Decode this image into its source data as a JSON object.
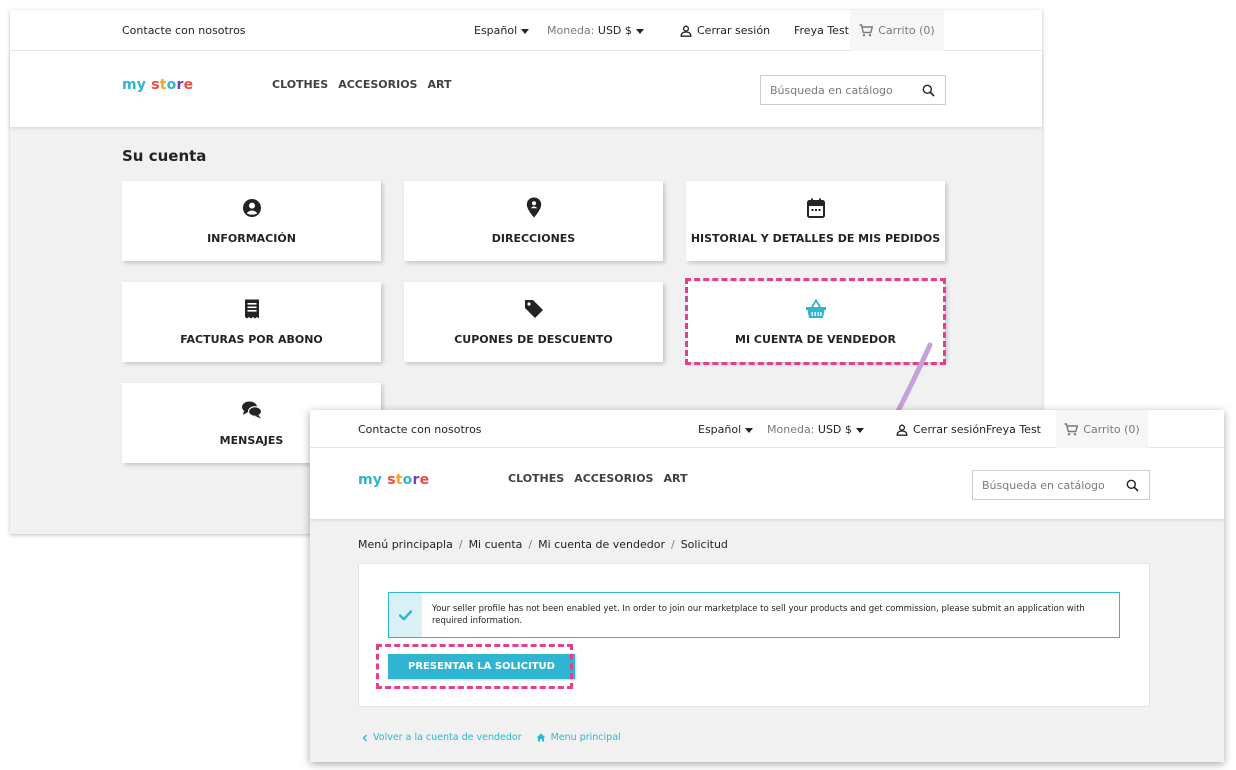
{
  "colors": {
    "accent": "#2fb5d2",
    "highlight_dash": "#e2408e",
    "arrow": "#c6a0d8"
  },
  "back": {
    "topbar": {
      "contact": "Contacte con nosotros",
      "language": "Español",
      "currency_label": "Moneda:",
      "currency_value": "USD $",
      "logout": "Cerrar sesión",
      "user": "Freya Test",
      "cart": "Carrito (0)"
    },
    "header": {
      "logo": [
        "my",
        " ",
        "s",
        "t",
        "o",
        "r",
        "e"
      ],
      "menu": [
        "CLOTHES",
        "ACCESORIOS",
        "ART"
      ],
      "search_placeholder": "Búsqueda en catálogo"
    },
    "title": "Su cuenta",
    "tiles": [
      {
        "label": "INFORMACIÓN",
        "icon": "user-circle-icon"
      },
      {
        "label": "DIRECCIONES",
        "icon": "location-pin-icon"
      },
      {
        "label": "HISTORIAL Y DETALLES DE MIS PEDIDOS",
        "icon": "calendar-icon"
      },
      {
        "label": "FACTURAS POR ABONO",
        "icon": "receipt-icon"
      },
      {
        "label": "CUPONES DE DESCUENTO",
        "icon": "tag-icon"
      },
      {
        "label": "MI CUENTA DE VENDEDOR",
        "icon": "basket-icon"
      },
      {
        "label": "MENSAJES",
        "icon": "chat-bubbles-icon"
      }
    ]
  },
  "front": {
    "topbar": {
      "contact": "Contacte con nosotros",
      "language": "Español",
      "currency_label": "Moneda:",
      "currency_value": "USD $",
      "logout": "Cerrar sesión",
      "user": "Freya Test",
      "cart": "Carrito (0)"
    },
    "header": {
      "menu": [
        "CLOTHES",
        "ACCESORIOS",
        "ART"
      ],
      "search_placeholder": "Búsqueda en catálogo"
    },
    "breadcrumb": [
      "Menú principapla",
      "Mi cuenta",
      "Mi cuenta de vendedor",
      "Solicitud"
    ],
    "alert_text": "Your seller profile has not been enabled yet. In order to join our marketplace to sell your products and get commission, please submit an application with required information.",
    "submit_button": "PRESENTAR LA SOLICITUD",
    "footer": {
      "back_link": "Volver a la cuenta de vendedor",
      "home_link": "Menu principal"
    }
  }
}
